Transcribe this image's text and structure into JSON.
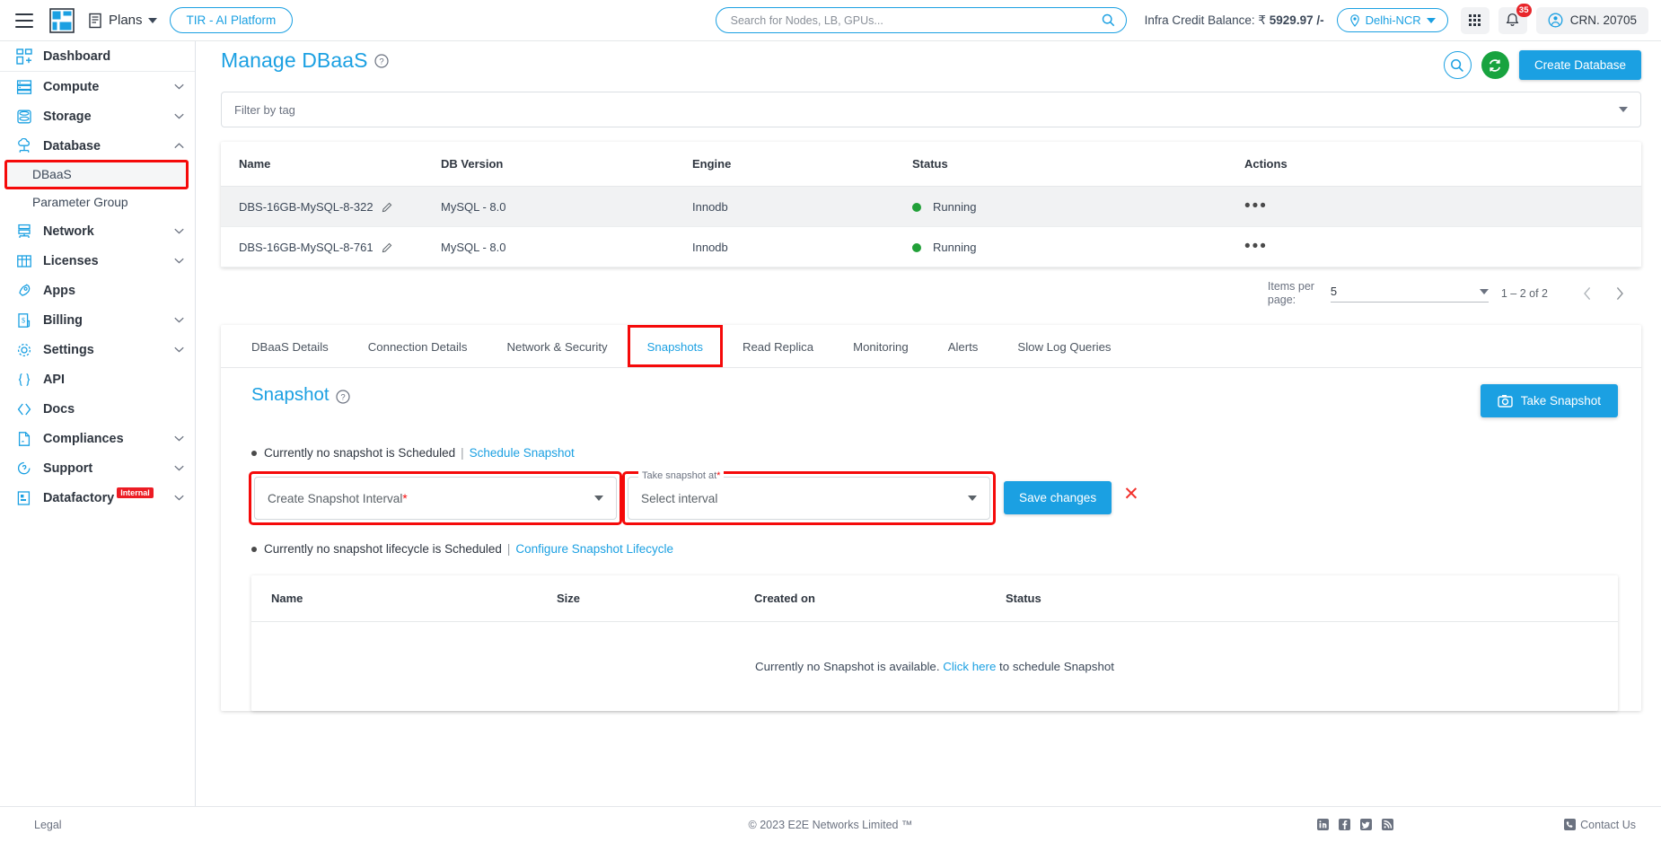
{
  "topbar": {
    "plans_label": "Plans",
    "tir_label": "TIR - AI Platform",
    "search_placeholder": "Search for Nodes, LB, GPUs...",
    "credit_label": "Infra Credit Balance: ₹",
    "credit_value": "5929.97 /-",
    "region": "Delhi-NCR",
    "notification_count": "35",
    "account": "CRN. 20705"
  },
  "sidebar": {
    "items": [
      {
        "label": "Dashboard",
        "icon": "dashboard-icon",
        "expandable": false
      },
      {
        "label": "Compute",
        "icon": "server-icon",
        "expandable": true
      },
      {
        "label": "Storage",
        "icon": "storage-icon",
        "expandable": true
      },
      {
        "label": "Database",
        "icon": "database-cloud-icon",
        "expandable": true,
        "expanded": true
      },
      {
        "label": "Network",
        "icon": "network-icon",
        "expandable": true
      },
      {
        "label": "Licenses",
        "icon": "licenses-icon",
        "expandable": true
      },
      {
        "label": "Apps",
        "icon": "rocket-icon",
        "expandable": false
      },
      {
        "label": "Billing",
        "icon": "billing-icon",
        "expandable": true
      },
      {
        "label": "Settings",
        "icon": "gear-icon",
        "expandable": true
      },
      {
        "label": "API",
        "icon": "braces-icon",
        "expandable": false
      },
      {
        "label": "Docs",
        "icon": "code-brackets-icon",
        "expandable": false
      },
      {
        "label": "Compliances",
        "icon": "document-icon",
        "expandable": true
      },
      {
        "label": "Support",
        "icon": "support-chat-icon",
        "expandable": true
      },
      {
        "label": "Datafactory",
        "icon": "datafactory-icon",
        "expandable": true,
        "badge": "Internal"
      }
    ],
    "sub_items": [
      {
        "label": "DBaaS",
        "active": true
      },
      {
        "label": "Parameter Group",
        "active": false
      }
    ]
  },
  "page": {
    "title": "Manage DBaaS",
    "filter_placeholder": "Filter by tag",
    "create_button": "Create Database"
  },
  "db_table": {
    "columns": [
      "Name",
      "DB Version",
      "Engine",
      "Status",
      "Actions"
    ],
    "rows": [
      {
        "name": "DBS-16GB-MySQL-8-322",
        "version": "MySQL - 8.0",
        "engine": "Innodb",
        "status": "Running",
        "status_color": "#21a038",
        "actions": "•••"
      },
      {
        "name": "DBS-16GB-MySQL-8-761",
        "version": "MySQL - 8.0",
        "engine": "Innodb",
        "status": "Running",
        "status_color": "#21a038",
        "actions": "•••"
      }
    ]
  },
  "pagination": {
    "items_per_page_label": "Items per page:",
    "items_per_page_value": "5",
    "range": "1 – 2 of 2"
  },
  "tabs": [
    {
      "label": "DBaaS Details",
      "active": false
    },
    {
      "label": "Connection Details",
      "active": false
    },
    {
      "label": "Network & Security",
      "active": false
    },
    {
      "label": "Snapshots",
      "active": true,
      "highlighted": true
    },
    {
      "label": "Read Replica",
      "active": false
    },
    {
      "label": "Monitoring",
      "active": false
    },
    {
      "label": "Alerts",
      "active": false
    },
    {
      "label": "Slow Log Queries",
      "active": false
    }
  ],
  "snapshot": {
    "title": "Snapshot",
    "take_snapshot_button": "Take Snapshot",
    "schedule_status": "Currently no snapshot is Scheduled",
    "schedule_link": "Schedule Snapshot",
    "separator": "|",
    "interval_field_label": "Create Snapshot Interval",
    "interval_required": "*",
    "take_at_legend": "Take snapshot at",
    "take_at_required": "*",
    "take_at_value": "Select interval",
    "save_button": "Save changes",
    "cancel_icon": "✕",
    "lifecycle_status": "Currently no snapshot lifecycle is Scheduled",
    "lifecycle_link": "Configure Snapshot Lifecycle"
  },
  "snapshot_table": {
    "columns": [
      "Name",
      "Size",
      "Created on",
      "Status"
    ],
    "empty_text_before": "Currently no Snapshot is available.",
    "empty_link": "Click here",
    "empty_text_after": "to schedule Snapshot"
  },
  "footer": {
    "legal": "Legal",
    "copyright": "© 2023 E2E Networks Limited ™",
    "contact": "Contact Us"
  },
  "colors": {
    "accent": "#1ba0e2",
    "highlight_red": "#f50a0a",
    "status_green": "#21a038",
    "badge_red": "#ec1c24"
  }
}
